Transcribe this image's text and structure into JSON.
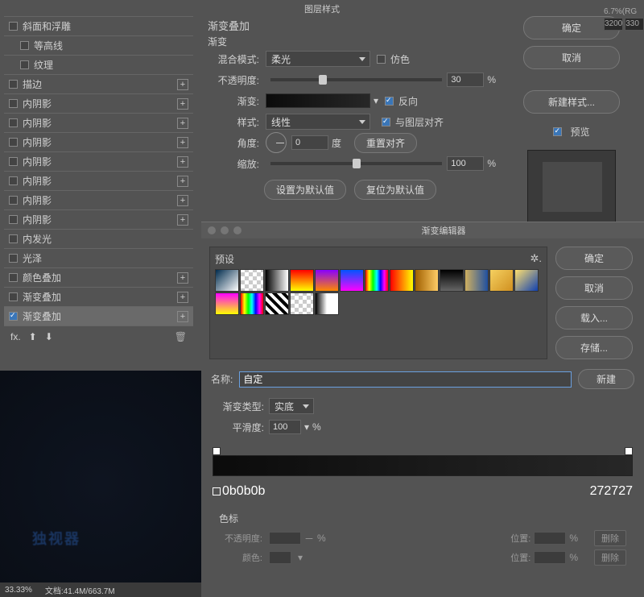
{
  "dialog_title": "图层样式",
  "styles": [
    {
      "label": "斜面和浮雕",
      "checked": false,
      "plus": false
    },
    {
      "label": "等高线",
      "checked": false,
      "indent": true,
      "plus": false
    },
    {
      "label": "纹理",
      "checked": false,
      "indent": true,
      "plus": false
    },
    {
      "label": "描边",
      "checked": false,
      "plus": true
    },
    {
      "label": "内阴影",
      "checked": false,
      "plus": true
    },
    {
      "label": "内阴影",
      "checked": false,
      "plus": true
    },
    {
      "label": "内阴影",
      "checked": false,
      "plus": true
    },
    {
      "label": "内阴影",
      "checked": false,
      "plus": true
    },
    {
      "label": "内阴影",
      "checked": false,
      "plus": true
    },
    {
      "label": "内阴影",
      "checked": false,
      "plus": true
    },
    {
      "label": "内阴影",
      "checked": false,
      "plus": true
    },
    {
      "label": "内发光",
      "checked": false,
      "plus": false
    },
    {
      "label": "光泽",
      "checked": false,
      "plus": false
    },
    {
      "label": "颜色叠加",
      "checked": false,
      "plus": true
    },
    {
      "label": "渐变叠加",
      "checked": false,
      "plus": true
    },
    {
      "label": "渐变叠加",
      "checked": true,
      "plus": true,
      "selected": true
    }
  ],
  "fx_label": "fx.",
  "panel": {
    "title": "渐变叠加",
    "subtitle": "渐变",
    "blend_label": "混合模式:",
    "blend_value": "柔光",
    "dither_label": "仿色",
    "opacity_label": "不透明度:",
    "opacity_value": "30",
    "pct": "%",
    "gradient_label": "渐变:",
    "reverse_label": "反向",
    "style_label": "样式:",
    "style_value": "线性",
    "align_label": "与图层对齐",
    "angle_label": "角度:",
    "angle_value": "0",
    "deg": "度",
    "reset_align": "重置对齐",
    "scale_label": "缩放:",
    "scale_value": "100",
    "set_default": "设置为默认值",
    "reset_default": "复位为默认值"
  },
  "buttons": {
    "ok": "确定",
    "cancel": "取消",
    "new_style": "新建样式...",
    "preview_label": "预览"
  },
  "right_strip": {
    "zoom": "6.7%(RG",
    "v1": "3200",
    "v2": "330"
  },
  "canvas_text": "独视器",
  "status": {
    "zoom": "33.33%",
    "doc": "文档:41.4M/663.7M"
  },
  "ge": {
    "title": "渐变编辑器",
    "presets_label": "预设",
    "ok": "确定",
    "cancel": "取消",
    "load": "载入...",
    "save": "存储...",
    "name_label": "名称:",
    "name_value": "自定",
    "new_btn": "新建",
    "type_label": "渐变类型:",
    "type_value": "实底",
    "smooth_label": "平滑度:",
    "smooth_value": "100",
    "pct": "%",
    "hex_left": "0b0b0b",
    "hex_right": "272727",
    "stops_title": "色标",
    "opacity_label": "不透明度:",
    "dash": "－",
    "pos_label": "位置:",
    "delete": "删除",
    "color_label": "颜色:"
  },
  "swatches": [
    "linear-gradient(135deg,#002b4d,#fff)",
    "repeating-conic-gradient(#ccc 0 25%,#fff 0 50%) 0/10px 10px",
    "linear-gradient(90deg,#000,#fff)",
    "linear-gradient(180deg,#f00,#ff0)",
    "linear-gradient(180deg,#80f,#f80)",
    "linear-gradient(180deg,#05f,#f0f)",
    "linear-gradient(90deg,#f00,#ff0,#0f0,#0ff,#00f,#f0f,#f00)",
    "linear-gradient(90deg,#f00,#ff0)",
    "linear-gradient(90deg,#a06000,#ffcc66)",
    "linear-gradient(180deg,#000,#666)",
    "linear-gradient(90deg,#d0b060,#2050a0)",
    "linear-gradient(135deg,#f5d060,#d09020)",
    "linear-gradient(135deg,#ffe070,#1040b0)",
    "linear-gradient(180deg,#f0f,#ff0)",
    "linear-gradient(90deg,#f00,#ff0,#0f0,#0ff,#00f,#f0f,#f00)",
    "repeating-linear-gradient(45deg,#000 0 4px,#fff 4px 8px)",
    "repeating-conic-gradient(#ccc 0 25%,#fff 0 50%) 0/10px 10px",
    "linear-gradient(90deg,#000,#fff,#fff)"
  ]
}
